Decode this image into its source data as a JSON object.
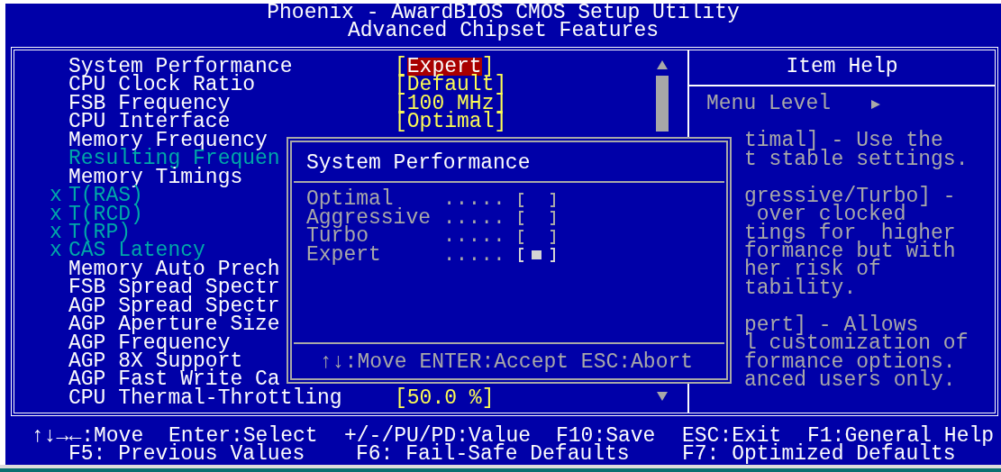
{
  "header": {
    "title": "Phoenix - AwardBIOS CMOS Setup Utility",
    "subtitle": "Advanced Chipset Features"
  },
  "settings": [
    {
      "label": "System Performance",
      "brackets": [
        "[",
        "]"
      ],
      "value": "Expert",
      "selected": true,
      "disabled": false
    },
    {
      "label": "CPU Clock Ratio",
      "brackets": [
        "[",
        "]"
      ],
      "value": "Default",
      "selected": false,
      "disabled": false
    },
    {
      "label": "FSB Frequency",
      "brackets": [
        "[",
        "]"
      ],
      "value": "100 MHz",
      "selected": false,
      "disabled": false
    },
    {
      "label": "CPU Interface",
      "brackets": [
        "[",
        "]"
      ],
      "value": "Optimal",
      "selected": false,
      "disabled": false
    },
    {
      "label": "Memory Frequency",
      "selected": false,
      "disabled": false
    },
    {
      "label": "Resulting Frequen",
      "selected": false,
      "disabled": true
    },
    {
      "label": "Memory Timings",
      "selected": false,
      "disabled": false
    },
    {
      "label": "T(RAS)",
      "marker": "x",
      "selected": false,
      "disabled": true
    },
    {
      "label": "T(RCD)",
      "marker": "x",
      "selected": false,
      "disabled": true
    },
    {
      "label": "T(RP)",
      "marker": "x",
      "selected": false,
      "disabled": true
    },
    {
      "label": "CAS Latency",
      "marker": "x",
      "selected": false,
      "disabled": true
    },
    {
      "label": "Memory Auto Prech",
      "selected": false,
      "disabled": false
    },
    {
      "label": "FSB Spread Spectr",
      "selected": false,
      "disabled": false
    },
    {
      "label": "AGP Spread Spectr",
      "selected": false,
      "disabled": false
    },
    {
      "label": "AGP Aperture Size",
      "selected": false,
      "disabled": false
    },
    {
      "label": "AGP Frequency",
      "selected": false,
      "disabled": false
    },
    {
      "label": "AGP 8X Support",
      "selected": false,
      "disabled": false
    },
    {
      "label": "AGP Fast Write Ca",
      "selected": false,
      "disabled": false
    },
    {
      "label": "CPU Thermal-Throttling",
      "brackets": [
        "[",
        "]"
      ],
      "value": "50.0 %",
      "selected": false,
      "disabled": false
    }
  ],
  "item_help": {
    "title": "Item Help",
    "menu_level": "Menu Level",
    "paragraphs": [
      [
        "timal] - Use the",
        "t stable settings."
      ],
      [
        "gressive/Turbo] -",
        " over clocked",
        "tings for  higher",
        "formance but with",
        "her risk of",
        "tability."
      ],
      [
        "pert] - Allows",
        "l customization of",
        "formance options.",
        "anced users only."
      ]
    ]
  },
  "dialog": {
    "title": "System Performance",
    "options": [
      {
        "label": "Optimal",
        "leader": ".....",
        "selected": false
      },
      {
        "label": "Aggressive",
        "leader": ".....",
        "selected": false
      },
      {
        "label": "Turbo",
        "leader": ".....",
        "selected": false
      },
      {
        "label": "Expert",
        "leader": ".....",
        "selected": true
      }
    ],
    "hint": "↑↓:Move ENTER:Accept ESC:Abort"
  },
  "key_help": [
    [
      "↑↓→←:Move",
      "Enter:Select",
      "+/-/PU/PD:Value",
      "F10:Save",
      "ESC:Exit",
      "F1:General Help"
    ],
    [
      "F5: Previous Values",
      "F6: Fail-Safe Defaults",
      "F7: Optimized Defaults"
    ]
  ]
}
